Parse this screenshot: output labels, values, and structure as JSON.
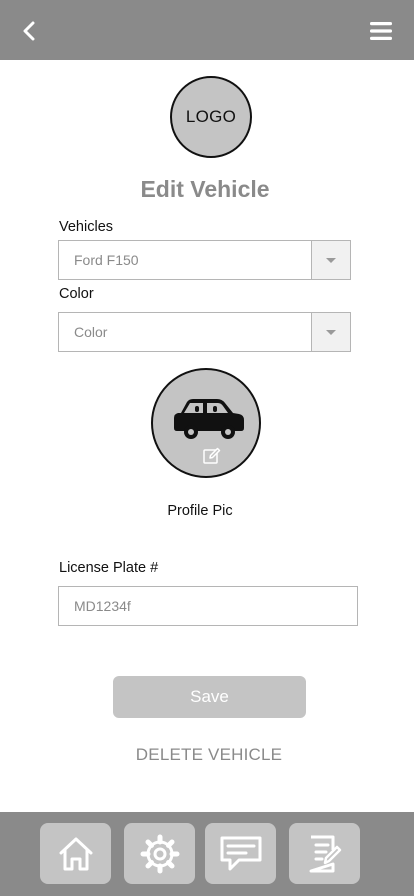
{
  "header": {
    "back_icon": "chevron-left-icon",
    "menu_icon": "hamburger-menu-icon"
  },
  "logo": {
    "text": "LOGO"
  },
  "page_title": "Edit Vehicle",
  "vehicles": {
    "label": "Vehicles",
    "selected": "Ford F150"
  },
  "color": {
    "label": "Color",
    "selected": "Color"
  },
  "profile_pic": {
    "icon": "car-icon",
    "edit_icon": "edit-icon",
    "caption": "Profile Pic"
  },
  "license_plate": {
    "label": "License Plate #",
    "value": "MD1234f"
  },
  "save_label": "Save",
  "delete_label": "DELETE VEHICLE",
  "bottom_nav": [
    {
      "icon": "home-icon"
    },
    {
      "icon": "settings-icon"
    },
    {
      "icon": "messages-icon"
    },
    {
      "icon": "notes-icon"
    }
  ],
  "colors": {
    "bar": "#8a8a8a",
    "placeholder_fill": "#c4c4c4",
    "muted_text": "#8a8a8a"
  }
}
